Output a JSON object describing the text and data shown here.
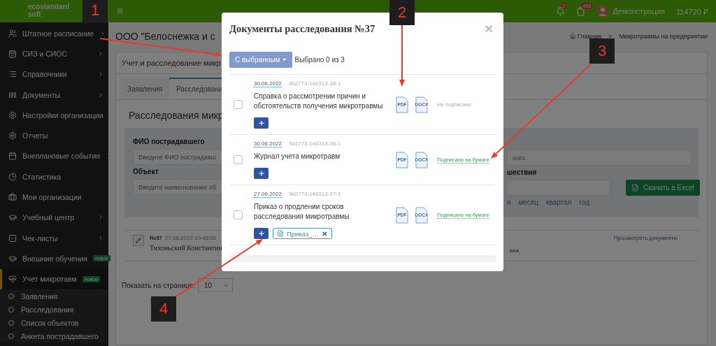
{
  "topbar": {
    "logo_lines": [
      "ecostandard",
      "soft"
    ],
    "menu_icon": "≡",
    "notifications_badge": "2",
    "tasks_badge": "458",
    "user": "Демонстрация",
    "balance": "114720 ₽"
  },
  "sidebar": {
    "items": [
      {
        "label": "Штатное расписание",
        "expandable": true,
        "selected": false
      },
      {
        "label": "СИЗ и СИОС",
        "expandable": true,
        "selected": false
      },
      {
        "label": "Справочники",
        "expandable": true,
        "selected": false
      },
      {
        "label": "Документы",
        "expandable": true,
        "selected": false
      },
      {
        "label": "Настройки организации",
        "expandable": false,
        "selected": false
      },
      {
        "label": "Отчеты",
        "expandable": false,
        "selected": false
      },
      {
        "label": "Внеплановые события",
        "expandable": true,
        "selected": false
      },
      {
        "label": "Статистика",
        "expandable": false,
        "selected": false
      },
      {
        "label": "Мои организации",
        "expandable": false,
        "selected": false
      },
      {
        "label": "Учебный центр",
        "expandable": true,
        "selected": false
      },
      {
        "label": "Чек-листы",
        "expandable": true,
        "selected": false
      },
      {
        "label": "Внешние обучения",
        "badge": "новое",
        "expandable": false,
        "selected": false
      },
      {
        "label": "Учет микротавм",
        "badge": "новое",
        "expandable": false,
        "selected": true
      }
    ],
    "sub_items": [
      "Заявления",
      "Расследования",
      "Список объектов",
      "Анкета пострадавшего"
    ]
  },
  "page": {
    "title": "ООО \"Белоснежка и с",
    "breadcrumb": [
      "Главная",
      "Микротравмы на предприятии"
    ],
    "breadcrumb_separator": ">",
    "panel_title": "Учет и расследование микр",
    "tabs": [
      {
        "label": "Заявления",
        "selected": false
      },
      {
        "label": "Расследовани",
        "selected": true
      }
    ],
    "section_title": "Расследования микр",
    "filters": {
      "left": [
        {
          "label": "ФИО пострадавшего",
          "placeholder": "Введите ФИО пострадавш"
        },
        {
          "label": "Объект",
          "placeholder": "Введите наименование об"
        }
      ],
      "right_field_placeholder": "ного",
      "right_label": "шествия",
      "period_links": [
        "я",
        "месяц",
        "квартал",
        "год"
      ],
      "excel_button": "Скачать в Excel"
    },
    "record": {
      "number": "№37",
      "datetime": "27.06.2022 10:46:00",
      "name": "Тихоньский Константин",
      "name_end": "вна",
      "docs_link": "Просмотреть документы"
    },
    "page_size": {
      "label": "Показать на странице:",
      "value": "10"
    }
  },
  "modal": {
    "title": "Документы расследования №37",
    "close": "×",
    "bulk_button": "С выбранным",
    "selected_count": "Выбрано 0 из 3",
    "documents": [
      {
        "checked": false,
        "date": "30.06.2022",
        "number": "№2773-146313-38-1",
        "title": "Справка о рассмотрении причин и обстоятельств получения микротравмы",
        "formats": [
          "PDF",
          "DOCX"
        ],
        "status": "Не подписано",
        "signed": false
      },
      {
        "checked": false,
        "date": "30.06.2022",
        "number": "№2773-146313-36-1",
        "title": "Журнал учета микротравм",
        "formats": [
          "PDF",
          "DOCX"
        ],
        "status": "Подписано на бумаге",
        "signed": true
      },
      {
        "checked": false,
        "date": "27.06.2022",
        "number": "№2773-146313-37-1",
        "title": "Приказ о продлении сроков расследования микротравмы",
        "formats": [
          "PDF",
          "DOCX"
        ],
        "status": "Подписано на бумаге",
        "signed": true,
        "attachments": [
          "Приказ_…"
        ]
      }
    ]
  },
  "annotations": [
    "1",
    "2",
    "3",
    "4"
  ]
}
